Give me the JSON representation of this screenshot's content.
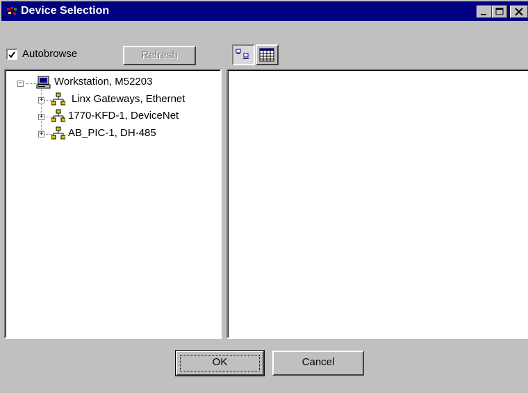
{
  "window": {
    "title": "Device Selection",
    "controls": {
      "minimize": "minimize",
      "maximize": "maximize",
      "close": "close"
    }
  },
  "toolbar": {
    "autobrowse_label": "Autobrowse",
    "autobrowse_checked": true,
    "refresh_label": "Refresh",
    "refresh_enabled": false,
    "view_mode": "large-icons"
  },
  "tree": {
    "root": {
      "label": "Workstation, M52203",
      "icon": "computer-icon",
      "expanded": true
    },
    "children": [
      {
        "label": "Linx Gateways, Ethernet",
        "icon": "network-icon",
        "expanded": false
      },
      {
        "label": "1770-KFD-1, DeviceNet",
        "icon": "network-icon",
        "expanded": false
      },
      {
        "label": "AB_PIC-1, DH-485",
        "icon": "network-icon",
        "expanded": false
      }
    ]
  },
  "buttons": {
    "ok": "OK",
    "cancel": "Cancel"
  },
  "colors": {
    "titlebar": "#000080",
    "face": "#c0c0c0",
    "network_icon": "#e0c000"
  }
}
